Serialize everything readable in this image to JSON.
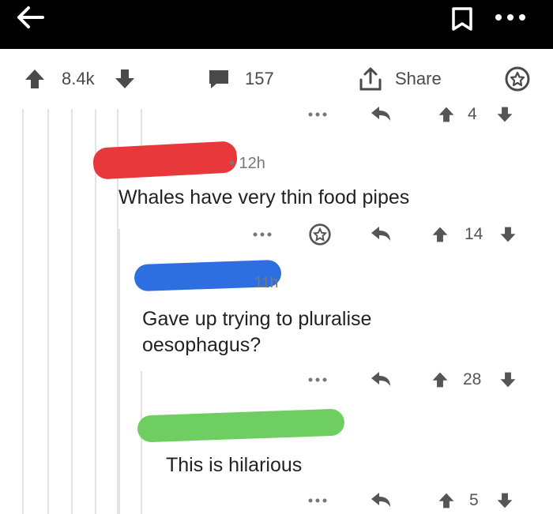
{
  "topbar": {
    "icons": [
      "back-arrow-icon",
      "bookmark-icon",
      "more-dots-icon"
    ]
  },
  "post_bar": {
    "score": "8.4k",
    "comments": "157",
    "share_label": "Share",
    "icons": [
      "upvote-icon",
      "downvote-icon",
      "comment-icon",
      "share-icon",
      "award-icon"
    ]
  },
  "comments": [
    {
      "partial_row": {
        "score": "4"
      }
    },
    {
      "redacted_color": "#e8383b",
      "time": "• 12h",
      "text": "Whales have very thin food pipes",
      "score": "14"
    },
    {
      "redacted_color": "#2d6fe0",
      "time": "11h",
      "text_line1": "Gave up trying to pluralise",
      "text_line2": "oesophagus?",
      "score": "28"
    },
    {
      "redacted_color": "#6fce61",
      "text": "This is hilarious",
      "score": "5"
    }
  ],
  "colors": {
    "topbar": "#000000",
    "icon_gray": "#4a4a4a",
    "thread_line": "#e3e3e3"
  }
}
